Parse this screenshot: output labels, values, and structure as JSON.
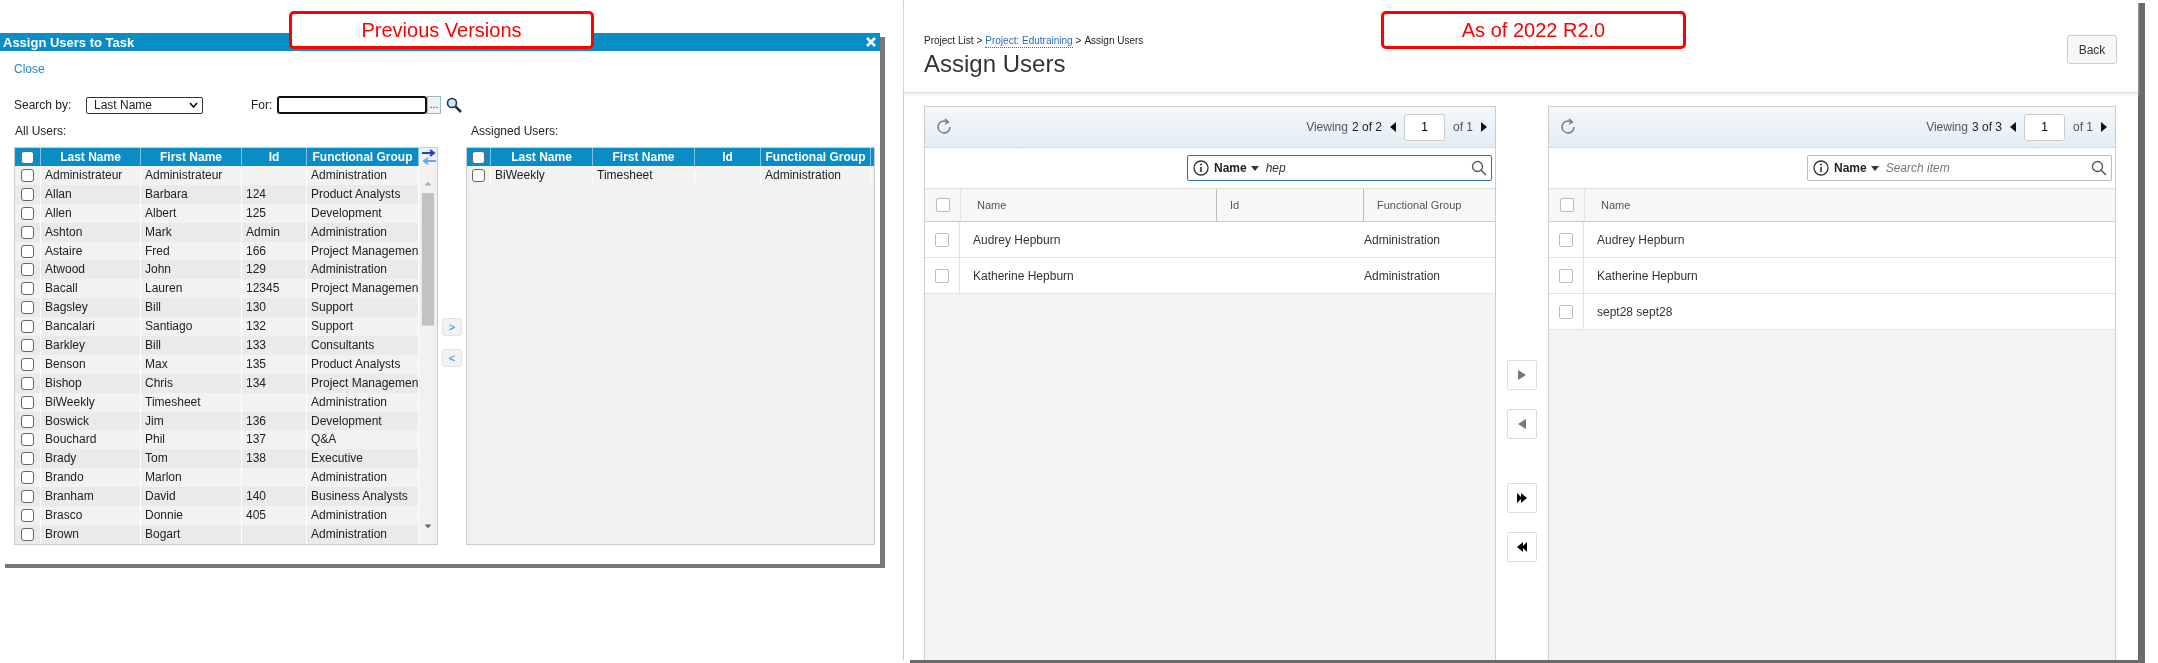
{
  "annotations": [
    {
      "text": "Previous Versions"
    },
    {
      "text": "As of 2022 R2.0"
    }
  ],
  "old_dialog": {
    "title": "Assign Users to Task",
    "close_link": "Close",
    "search_by_label": "Search by:",
    "search_by_value": "Last Name",
    "for_label": "For:",
    "lookup_button": "...",
    "all_users_label": "All Users:",
    "assigned_users_label": "Assigned Users:",
    "all_users": {
      "select_all_checked": false,
      "columns": [
        "Last Name",
        "First Name",
        "Id",
        "Functional Group"
      ],
      "rows": [
        {
          "last_name": "Administrateur",
          "first_name": "Administrateur",
          "functional_group": "Administration",
          "checked": false
        },
        {
          "last_name": "Allan",
          "first_name": "Barbara",
          "id": "124",
          "functional_group": "Product Analysts",
          "checked": false
        },
        {
          "last_name": "Allen",
          "first_name": "Albert",
          "id": "125",
          "functional_group": "Development",
          "checked": false
        },
        {
          "last_name": "Ashton",
          "first_name": "Mark",
          "id": "Admin",
          "functional_group": "Administration",
          "checked": false
        },
        {
          "last_name": "Astaire",
          "first_name": "Fred",
          "id": "166",
          "functional_group": "Project Managemen",
          "checked": false
        },
        {
          "last_name": "Atwood",
          "first_name": "John",
          "id": "129",
          "functional_group": "Administration",
          "checked": false
        },
        {
          "last_name": "Bacall",
          "first_name": "Lauren",
          "id": "12345",
          "functional_group": "Project Managemen",
          "checked": false
        },
        {
          "last_name": "Bagsley",
          "first_name": "Bill",
          "id": "130",
          "functional_group": "Support",
          "checked": false
        },
        {
          "last_name": "Bancalari",
          "first_name": "Santiago",
          "id": "132",
          "functional_group": "Support",
          "checked": false
        },
        {
          "last_name": "Barkley",
          "first_name": "Bill",
          "id": "133",
          "functional_group": "Consultants",
          "checked": false
        },
        {
          "last_name": "Benson",
          "first_name": "Max",
          "id": "135",
          "functional_group": "Product Analysts",
          "checked": false
        },
        {
          "last_name": "Bishop",
          "first_name": "Chris",
          "id": "134",
          "functional_group": "Project Managemen",
          "checked": false
        },
        {
          "last_name": "BiWeekly",
          "first_name": "Timesheet",
          "functional_group": "Administration",
          "checked": false
        },
        {
          "last_name": "Boswick",
          "first_name": "Jim",
          "id": "136",
          "functional_group": "Development",
          "checked": false
        },
        {
          "last_name": "Bouchard",
          "first_name": "Phil",
          "id": "137",
          "functional_group": "Q&A",
          "checked": false
        },
        {
          "last_name": "Brady",
          "first_name": "Tom",
          "id": "138",
          "functional_group": "Executive",
          "checked": false
        },
        {
          "last_name": "Brando",
          "first_name": "Marlon",
          "functional_group": "Administration",
          "checked": false
        },
        {
          "last_name": "Branham",
          "first_name": "David",
          "id": "140",
          "functional_group": "Business Analysts",
          "checked": false
        },
        {
          "last_name": "Brasco",
          "first_name": "Donnie",
          "id": "405",
          "functional_group": "Administration",
          "checked": false
        },
        {
          "last_name": "Brown",
          "first_name": "Bogart",
          "functional_group": "Administration",
          "checked": false
        }
      ]
    },
    "move_buttons": [
      ">",
      "<"
    ],
    "assigned_users": {
      "select_all_checked": false,
      "columns": [
        "Last Name",
        "First Name",
        "Id",
        "Functional Group"
      ],
      "rows": [
        {
          "last_name": "BiWeekly",
          "first_name": "Timesheet",
          "functional_group": "Administration",
          "checked": false
        }
      ]
    }
  },
  "new_page": {
    "breadcrumb": [
      {
        "kind": "crumb",
        "text": "Project List"
      },
      {
        "kind": "separator",
        "text": ">"
      },
      {
        "kind": "link",
        "text": "Project: Edutraining"
      },
      {
        "kind": "separator",
        "text": ">"
      },
      {
        "kind": "crumb",
        "text": "Assign Users"
      }
    ],
    "title": "Assign Users",
    "back_button": "Back",
    "available": {
      "viewing_label": "Viewing",
      "count": "2 of 2",
      "page": "1",
      "page_total": "of 1",
      "search": {
        "filter": "Name",
        "value": "hep",
        "focused": true
      },
      "select_all_checked": false,
      "columns": [
        "Name",
        "Id",
        "Functional Group"
      ],
      "rows": [
        {
          "name": "Audrey Hepburn",
          "functional_group": "Administration",
          "checked": false
        },
        {
          "name": "Katherine Hepburn",
          "functional_group": "Administration",
          "checked": false
        }
      ]
    },
    "transfer_buttons": [
      {
        "kind": "move_right",
        "disabled": true
      },
      {
        "kind": "move_left",
        "disabled": true
      },
      {
        "kind": "move_all_right",
        "disabled": false
      },
      {
        "kind": "move_all_left",
        "disabled": false
      }
    ],
    "assigned": {
      "viewing_label": "Viewing",
      "count": "3 of 3",
      "page": "1",
      "page_total": "of 1",
      "search": {
        "filter": "Name",
        "placeholder": "Search item",
        "focused": false
      },
      "select_all_checked": false,
      "columns": [
        "Name"
      ],
      "rows": [
        {
          "name": "Audrey Hepburn",
          "checked": false
        },
        {
          "name": "Katherine Hepburn",
          "checked": false
        },
        {
          "name": "sept28 sept28",
          "checked": false
        }
      ]
    }
  }
}
